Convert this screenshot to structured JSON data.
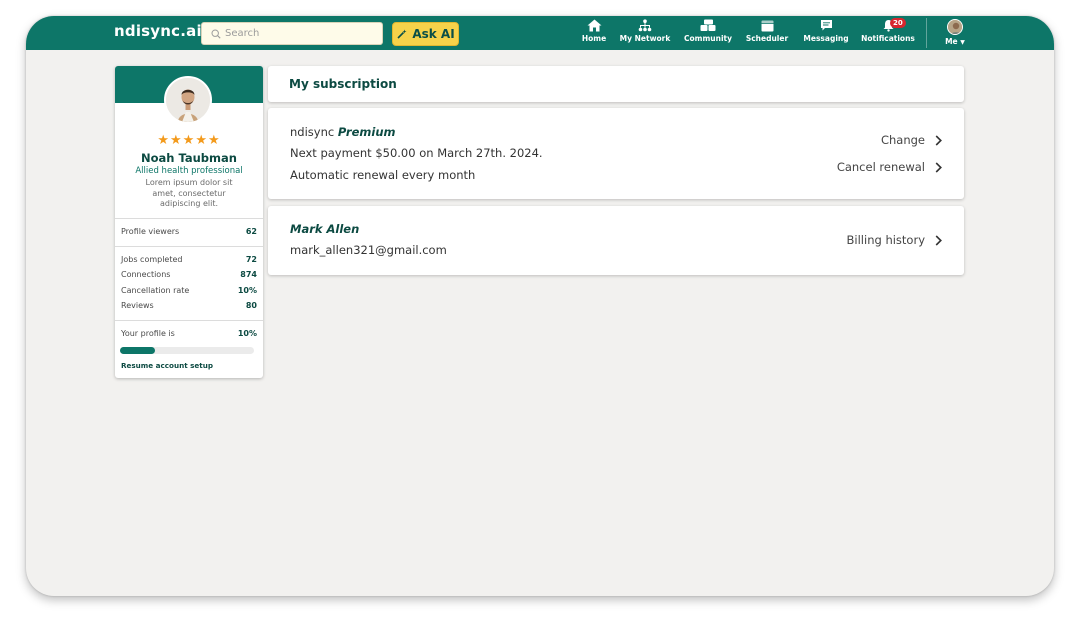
{
  "app": {
    "brand": "ndisync.ai"
  },
  "search": {
    "placeholder": "Search"
  },
  "ask_ai": {
    "label": "Ask AI"
  },
  "nav": {
    "home": "Home",
    "network": "My Network",
    "community": "Community",
    "scheduler": "Scheduler",
    "messaging": "Messaging",
    "notifications": "Notifications",
    "notifications_count": "20",
    "me": "Me"
  },
  "profile": {
    "stars": "★★★★★",
    "name": "Noah Taubman",
    "role": "Allied health professional",
    "bio": "Lorem ipsum dolor sit amet, consectetur adipiscing elit.",
    "stats": [
      {
        "label": "Profile viewers",
        "value": "62"
      },
      {
        "label": "Jobs completed",
        "value": "72"
      },
      {
        "label": "Connections",
        "value": "874"
      },
      {
        "label": "Cancellation rate",
        "value": "10%"
      },
      {
        "label": "Reviews",
        "value": "80"
      }
    ],
    "completion_label": "Your profile is",
    "completion_value": "10%",
    "completion_fraction": 0.26,
    "resume_link": "Resume account setup"
  },
  "subscription": {
    "title": "My subscription",
    "plan_prefix": "ndisync",
    "plan_name": "Premium",
    "next_payment": "Next payment $50.00 on March 27th. 2024.",
    "renewal": "Automatic renewal every month",
    "change_label": "Change",
    "cancel_label": "Cancel renewal"
  },
  "account": {
    "name": "Mark Allen",
    "email": "mark_allen321@gmail.com",
    "billing_label": "Billing history"
  },
  "colors": {
    "primary": "#0d7668",
    "dark_text": "#0c4a42",
    "accent_yellow": "#f6d24a",
    "star": "#f39a1c",
    "badge": "#d7262e",
    "background": "#f2f1ef"
  },
  "icons": [
    "search-icon",
    "wand-icon",
    "home-icon",
    "network-icon",
    "community-icon",
    "scheduler-icon",
    "messaging-icon",
    "bell-icon",
    "caret-down-icon",
    "chevron-right-icon"
  ]
}
